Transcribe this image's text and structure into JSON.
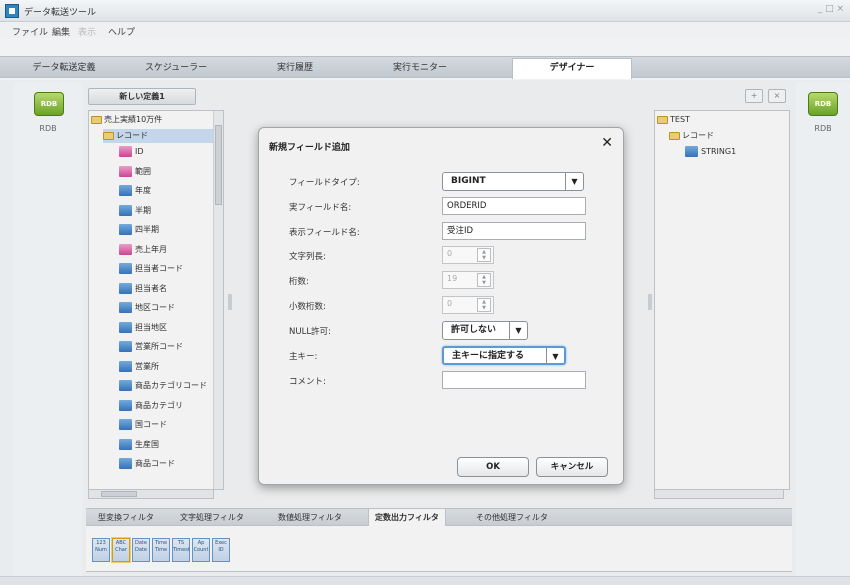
{
  "app": {
    "title": "データ転送ツール",
    "window_controls": "_ □ ×"
  },
  "menu": [
    "ファイル",
    "編集",
    "表示",
    "ヘルプ"
  ],
  "tabs": [
    "データ転送定義",
    "スケジューラー",
    "実行履歴",
    "実行モニター",
    "デザイナー"
  ],
  "side": {
    "left_label": "RDB",
    "right_label": "RDB",
    "icon_text": "RDB"
  },
  "toolbar": {
    "def_tab": "新しい定義1",
    "add": "+",
    "remove": "×"
  },
  "left_tree": {
    "root": "売上実績10万件",
    "record": "レコード",
    "fields": [
      {
        "label": "ID",
        "color": "pink"
      },
      {
        "label": "範囲",
        "color": "pink"
      },
      {
        "label": "年度",
        "color": "blue"
      },
      {
        "label": "半期",
        "color": "blue"
      },
      {
        "label": "四半期",
        "color": "blue"
      },
      {
        "label": "売上年月",
        "color": "pink"
      },
      {
        "label": "担当者コード",
        "color": "blue"
      },
      {
        "label": "担当者名",
        "color": "blue"
      },
      {
        "label": "地区コード",
        "color": "blue"
      },
      {
        "label": "担当地区",
        "color": "blue"
      },
      {
        "label": "営業所コード",
        "color": "blue"
      },
      {
        "label": "営業所",
        "color": "blue"
      },
      {
        "label": "商品カテゴリコード",
        "color": "blue"
      },
      {
        "label": "商品カテゴリ",
        "color": "blue"
      },
      {
        "label": "国コード",
        "color": "blue"
      },
      {
        "label": "生産国",
        "color": "blue"
      },
      {
        "label": "商品コード",
        "color": "blue"
      }
    ]
  },
  "right_tree": {
    "root": "TEST",
    "record": "レコード",
    "field": "STRING1"
  },
  "filters": [
    "型変換フィルタ",
    "文字処理フィルタ",
    "数値処理フィルタ",
    "定数出力フィルタ",
    "その他処理フィルタ"
  ],
  "palette": [
    {
      "top": "123",
      "bottom": "Num"
    },
    {
      "top": "ABC",
      "bottom": "Char"
    },
    {
      "top": "Date",
      "bottom": "Date"
    },
    {
      "top": "Time",
      "bottom": "Time"
    },
    {
      "top": "TS",
      "bottom": "Timest"
    },
    {
      "top": "Ap",
      "bottom": "Count"
    },
    {
      "top": "Exec",
      "bottom": "ID"
    }
  ],
  "dialog": {
    "title": "新規フィールド追加",
    "close": "✕",
    "labels": {
      "field_type": "フィールドタイプ:",
      "real_name": "実フィールド名:",
      "display_name": "表示フィールド名:",
      "char_length": "文字列長:",
      "digits": "桁数:",
      "decimals": "小数桁数:",
      "nullable": "NULL許可:",
      "primary_key": "主キー:",
      "comment": "コメント:"
    },
    "values": {
      "field_type": "BIGINT",
      "real_name": "ORDERID",
      "display_name": "受注ID",
      "char_length": "0",
      "digits": "19",
      "decimals": "0",
      "nullable": "許可しない",
      "primary_key": "主キーに指定する",
      "comment": ""
    },
    "ok": "OK",
    "cancel": "キャンセル"
  }
}
